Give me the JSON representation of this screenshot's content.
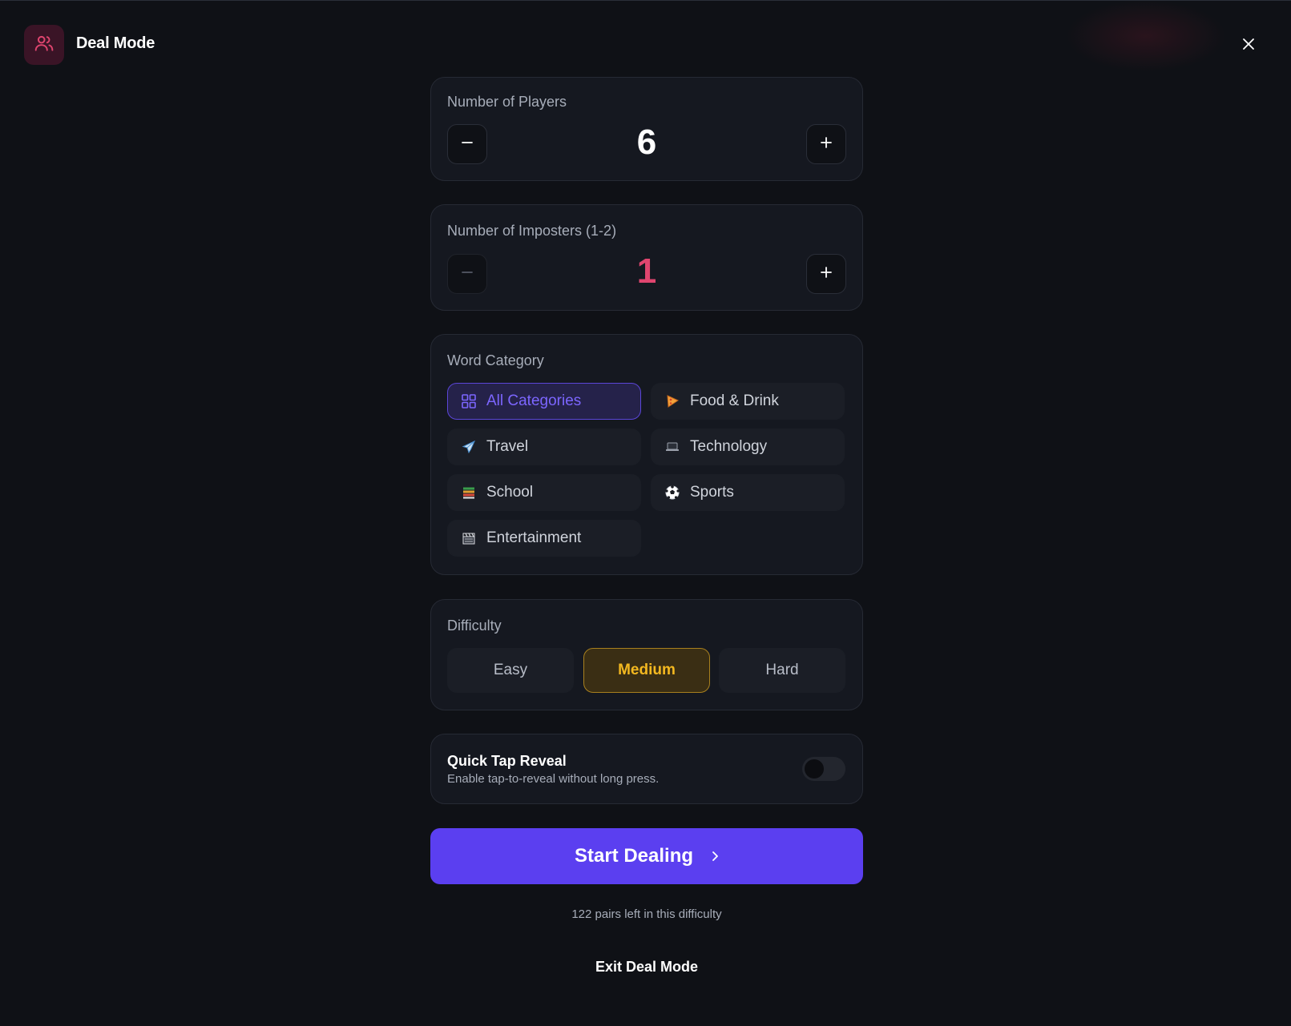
{
  "app": {
    "title": "Deal Mode",
    "accent_color": "#e0456f",
    "logo_icon": "users-icon",
    "close_icon": "close-icon"
  },
  "players": {
    "label": "Number of Players",
    "value": "6",
    "decrement_icon": "minus-icon",
    "increment_icon": "plus-icon"
  },
  "imposters": {
    "label": "Number of Imposters (1-2)",
    "value": "1",
    "value_color": "#e0456f",
    "decrement_icon": "minus-icon",
    "increment_icon": "plus-icon"
  },
  "category": {
    "label": "Word Category",
    "selected": "All Categories",
    "items": [
      {
        "label": "All Categories",
        "icon": "grid-icon",
        "active": true
      },
      {
        "label": "Food & Drink",
        "icon": "pizza-icon",
        "glyph": "🍕"
      },
      {
        "label": "Travel",
        "icon": "airplane-icon",
        "glyph": "✈"
      },
      {
        "label": "Technology",
        "icon": "laptop-icon",
        "glyph": "💻"
      },
      {
        "label": "School",
        "icon": "books-icon",
        "glyph": "📚"
      },
      {
        "label": "Sports",
        "icon": "soccer-ball-icon",
        "glyph": "⚽"
      },
      {
        "label": "Entertainment",
        "icon": "clapperboard-icon",
        "glyph": "🎬"
      }
    ]
  },
  "difficulty": {
    "label": "Difficulty",
    "options": [
      "Easy",
      "Medium",
      "Hard"
    ],
    "selected": "Medium",
    "selected_color": "#f3b820"
  },
  "quick_tap": {
    "title": "Quick Tap Reveal",
    "description": "Enable tap-to-reveal without long press.",
    "enabled": false
  },
  "start": {
    "label": "Start Dealing",
    "icon": "chevron-right-icon",
    "color": "#5b3ff0"
  },
  "pairs_left_text": "122 pairs left in this difficulty",
  "exit_label": "Exit Deal Mode"
}
